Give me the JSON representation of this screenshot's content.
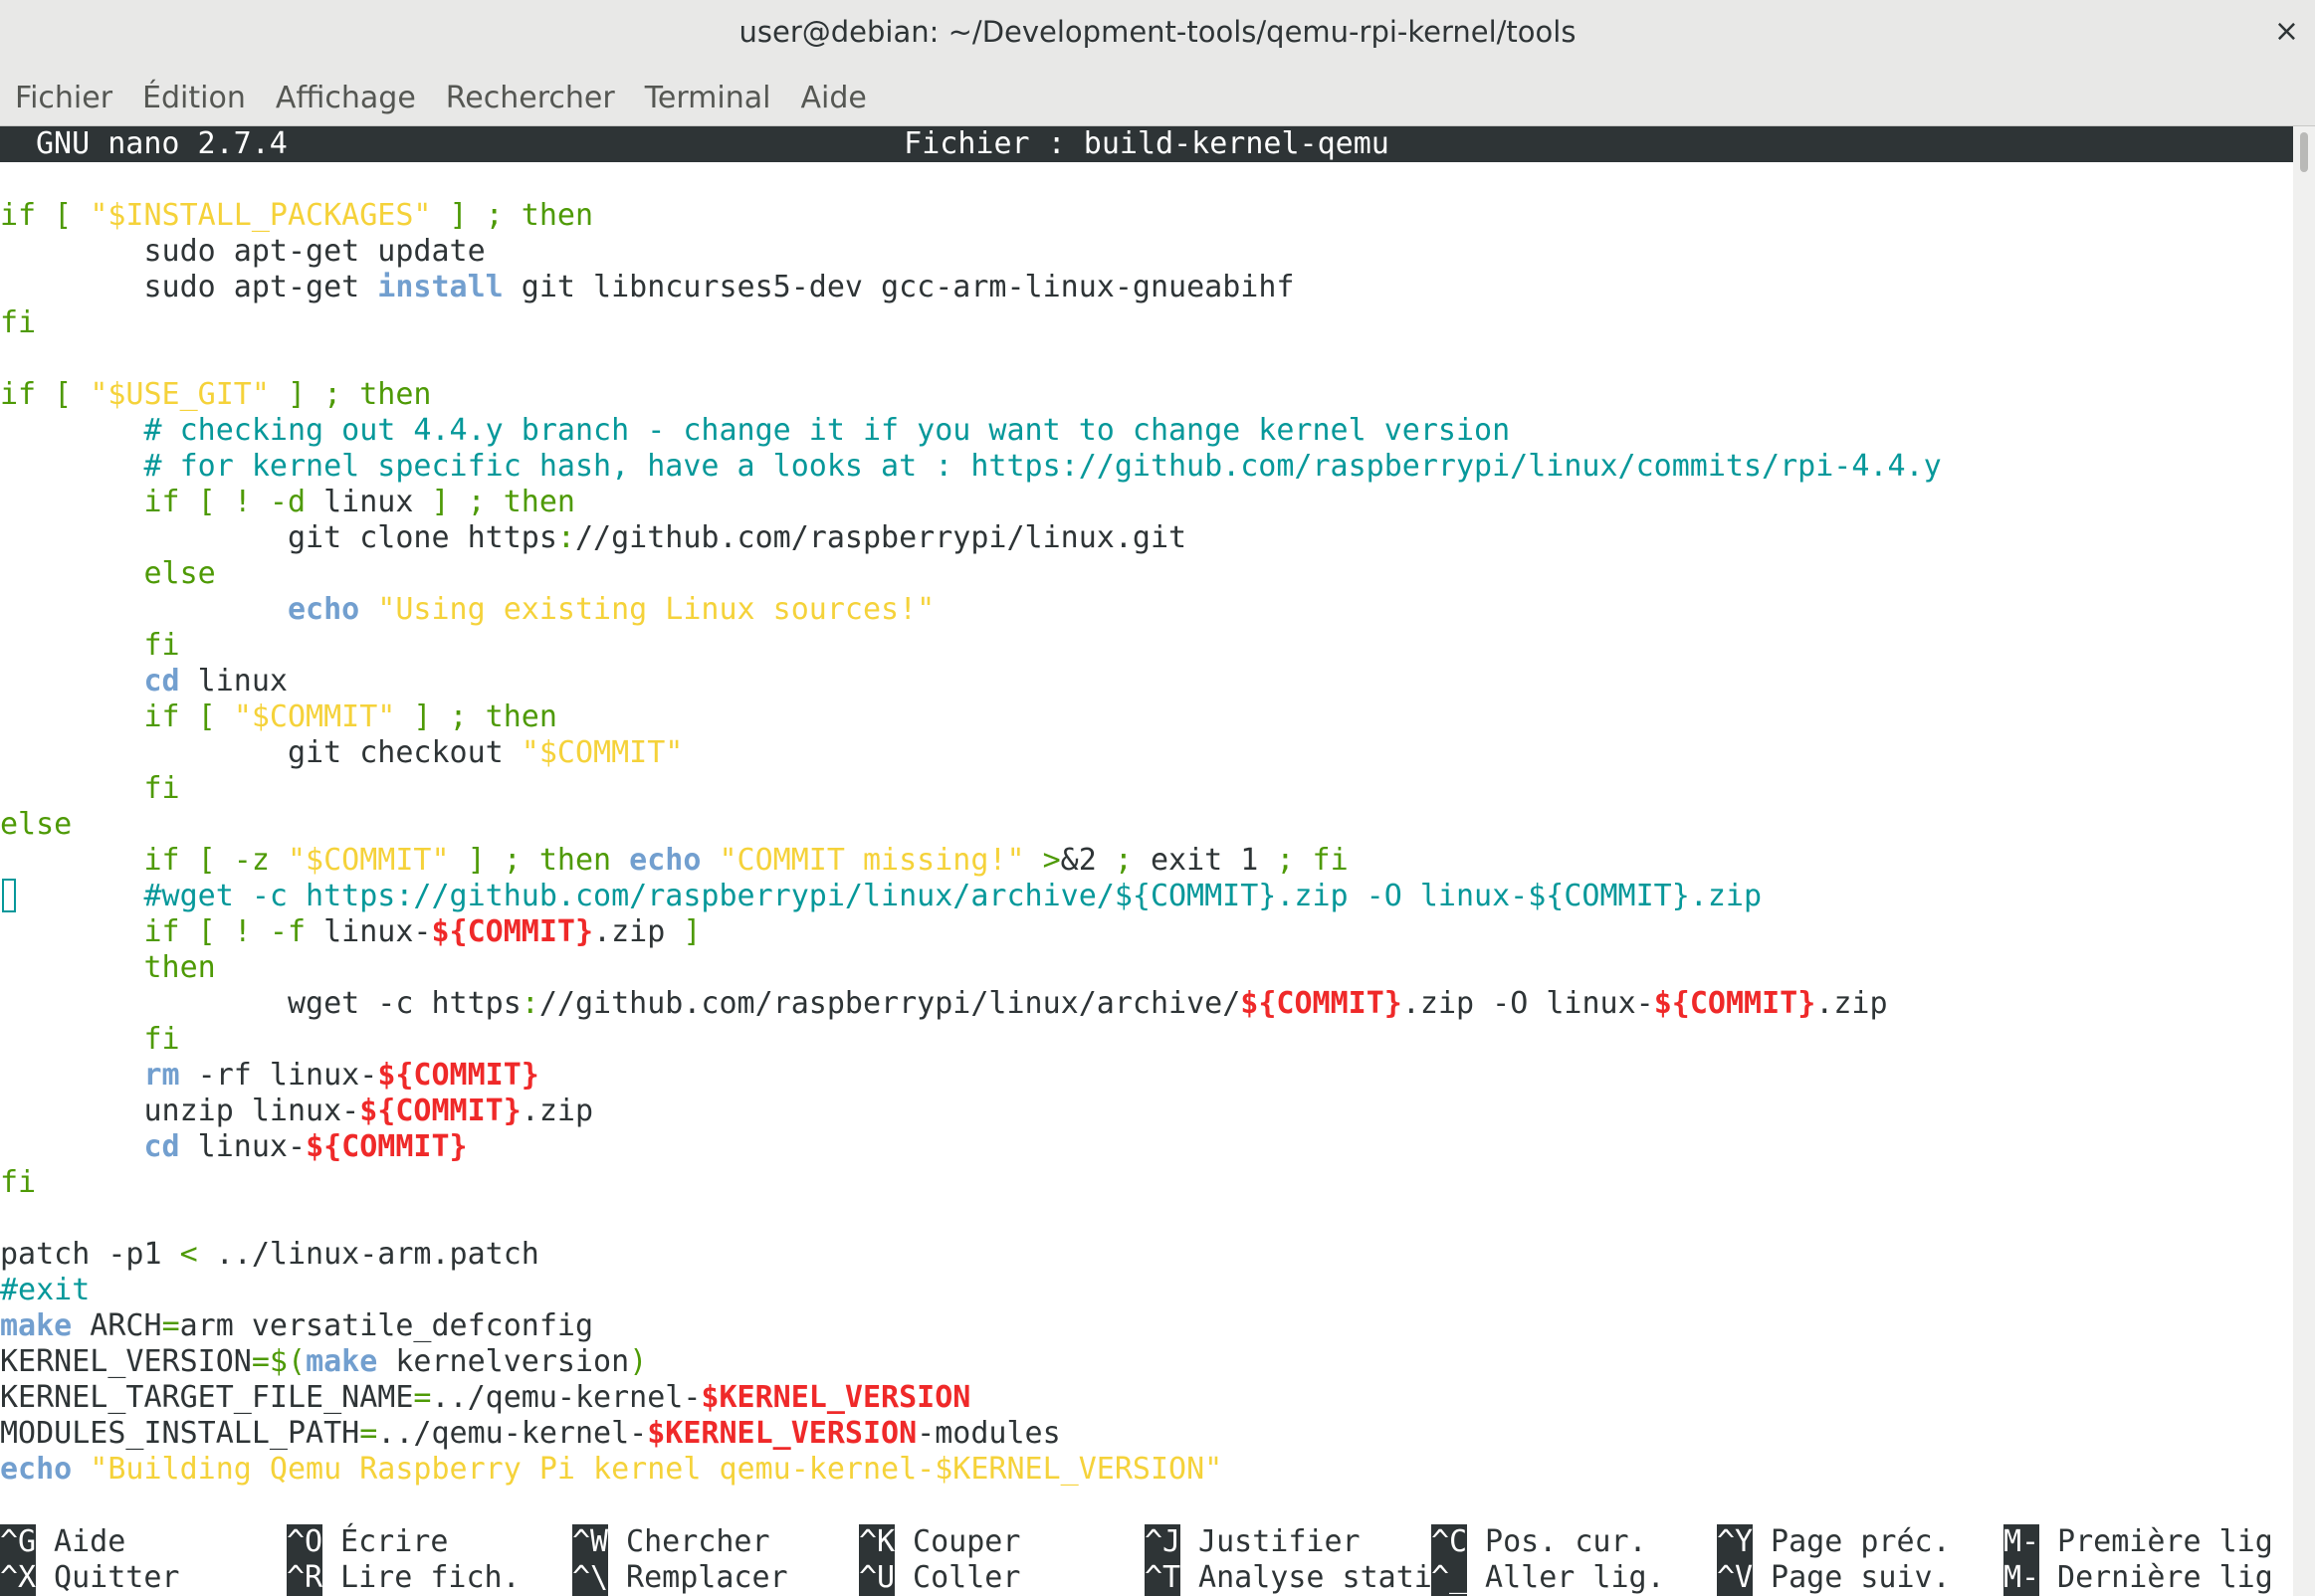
{
  "window": {
    "title": "user@debian: ~/Development-tools/qemu-rpi-kernel/tools",
    "close_glyph": "×"
  },
  "menubar": [
    "Fichier",
    "Édition",
    "Affichage",
    "Rechercher",
    "Terminal",
    "Aide"
  ],
  "nano": {
    "version": "GNU nano 2.7.4",
    "file": "Fichier : build-kernel-qemu"
  },
  "code_lines": [
    [],
    [
      [
        "kw",
        "if [ "
      ],
      [
        "st",
        "\"$INSTALL_PACKAGES\""
      ],
      [
        "kw",
        " ] ; then"
      ]
    ],
    [
      [
        "",
        "        sudo apt-get update"
      ]
    ],
    [
      [
        "",
        "        sudo apt-get "
      ],
      [
        "cmd",
        "install"
      ],
      [
        "",
        " git libncurses5-dev gcc-arm-linux-gnueabihf"
      ]
    ],
    [
      [
        "kw",
        "fi"
      ]
    ],
    [],
    [
      [
        "kw",
        "if [ "
      ],
      [
        "st",
        "\"$USE_GIT\""
      ],
      [
        "kw",
        " ] ; then"
      ]
    ],
    [
      [
        "cm",
        "        # checking out 4.4.y branch - change it if you want to change kernel version"
      ]
    ],
    [
      [
        "cm",
        "        # for kernel specific hash, have a looks at : https://github.com/raspberrypi/linux/commits/rpi-4.4.y"
      ]
    ],
    [
      [
        "kw",
        "        if [ ! -d "
      ],
      [
        "",
        "linux"
      ],
      [
        "kw",
        " ] ; then"
      ]
    ],
    [
      [
        "",
        "                git clone https"
      ],
      [
        "kw",
        ":"
      ],
      [
        "",
        "//github.com/raspberrypi/linux.git"
      ]
    ],
    [
      [
        "kw",
        "        else"
      ]
    ],
    [
      [
        "",
        "                "
      ],
      [
        "cmd",
        "echo"
      ],
      [
        "st",
        " \"Using existing Linux sources!\""
      ]
    ],
    [
      [
        "kw",
        "        fi"
      ]
    ],
    [
      [
        "",
        "        "
      ],
      [
        "cmd",
        "cd"
      ],
      [
        "",
        " linux"
      ]
    ],
    [
      [
        "kw",
        "        if [ "
      ],
      [
        "st",
        "\"$COMMIT\""
      ],
      [
        "kw",
        " ] ; then"
      ]
    ],
    [
      [
        "",
        "                git checkout "
      ],
      [
        "st",
        "\"$COMMIT\""
      ]
    ],
    [
      [
        "kw",
        "        fi"
      ]
    ],
    [
      [
        "kw",
        "else"
      ]
    ],
    [
      [
        "kw",
        "        if [ -z "
      ],
      [
        "st",
        "\"$COMMIT\""
      ],
      [
        "kw",
        " ] ; then "
      ],
      [
        "cmd",
        "echo"
      ],
      [
        "st",
        " \"COMMIT missing!\""
      ],
      [
        "kw",
        " >"
      ],
      [
        "",
        "&2"
      ],
      [
        "kw",
        " ; "
      ],
      [
        "",
        "exit 1"
      ],
      [
        "kw",
        " ; fi"
      ]
    ],
    [
      [
        "cm",
        "        #wget -c https://github.com/raspberrypi/linux/archive/${COMMIT}.zip -O linux-${COMMIT}.zip"
      ]
    ],
    [
      [
        "kw",
        "        if [ ! -f "
      ],
      [
        "",
        "linux-"
      ],
      [
        "var",
        "${COMMIT}"
      ],
      [
        "",
        ".zip"
      ],
      [
        "kw",
        " ]"
      ]
    ],
    [
      [
        "kw",
        "        then"
      ]
    ],
    [
      [
        "",
        "                wget -c https"
      ],
      [
        "kw",
        ":"
      ],
      [
        "",
        "//github.com/raspberrypi/linux/archive/"
      ],
      [
        "var",
        "${COMMIT}"
      ],
      [
        "",
        ".zip -O linux-"
      ],
      [
        "var",
        "${COMMIT}"
      ],
      [
        "",
        ".zip"
      ]
    ],
    [
      [
        "kw",
        "        fi"
      ]
    ],
    [
      [
        "",
        "        "
      ],
      [
        "cmd",
        "rm"
      ],
      [
        "",
        " -rf linux-"
      ],
      [
        "var",
        "${COMMIT}"
      ]
    ],
    [
      [
        "",
        "        unzip linux-"
      ],
      [
        "var",
        "${COMMIT}"
      ],
      [
        "",
        ".zip"
      ]
    ],
    [
      [
        "",
        "        "
      ],
      [
        "cmd",
        "cd"
      ],
      [
        "",
        " linux-"
      ],
      [
        "var",
        "${COMMIT}"
      ]
    ],
    [
      [
        "kw",
        "fi"
      ]
    ],
    [],
    [
      [
        "",
        "patch -p1 "
      ],
      [
        "kw",
        "<"
      ],
      [
        "",
        " ../linux-arm.patch"
      ]
    ],
    [
      [
        "cm",
        "#exit"
      ]
    ],
    [
      [
        "cmd",
        "make"
      ],
      [
        "",
        " ARCH"
      ],
      [
        "kw",
        "="
      ],
      [
        "",
        "arm versatile_defconfig"
      ]
    ],
    [
      [
        "",
        "KERNEL_VERSION"
      ],
      [
        "kw",
        "=$("
      ],
      [
        "cmd",
        "make"
      ],
      [
        "",
        " kernelversion"
      ],
      [
        "kw",
        ")"
      ]
    ],
    [
      [
        "",
        "KERNEL_TARGET_FILE_NAME"
      ],
      [
        "kw",
        "="
      ],
      [
        "",
        "../qemu-kernel-"
      ],
      [
        "var",
        "$KERNEL_VERSION"
      ]
    ],
    [
      [
        "",
        "MODULES_INSTALL_PATH"
      ],
      [
        "kw",
        "="
      ],
      [
        "",
        "../qemu-kernel-"
      ],
      [
        "var",
        "$KERNEL_VERSION"
      ],
      [
        "",
        "-modules"
      ]
    ],
    [
      [
        "cmd",
        "echo"
      ],
      [
        "st",
        " \"Building Qemu Raspberry Pi kernel qemu-kernel-$KERNEL_VERSION\""
      ]
    ]
  ],
  "shortcuts": [
    [
      {
        "key": "^G",
        "label": "Aide"
      },
      {
        "key": "^O",
        "label": "Écrire"
      },
      {
        "key": "^W",
        "label": "Chercher"
      },
      {
        "key": "^K",
        "label": "Couper"
      },
      {
        "key": "^J",
        "label": "Justifier"
      },
      {
        "key": "^C",
        "label": "Pos. cur."
      },
      {
        "key": "^Y",
        "label": "Page préc."
      },
      {
        "key": "M-\\",
        "label": "Première lig"
      }
    ],
    [
      {
        "key": "^X",
        "label": "Quitter"
      },
      {
        "key": "^R",
        "label": "Lire fich."
      },
      {
        "key": "^\\",
        "label": "Remplacer"
      },
      {
        "key": "^U",
        "label": "Coller"
      },
      {
        "key": "^T",
        "label": "Analyse stati"
      },
      {
        "key": "^_",
        "label": "Aller lig."
      },
      {
        "key": "^V",
        "label": "Page suiv."
      },
      {
        "key": "M-/",
        "label": "Dernière lig"
      }
    ]
  ]
}
